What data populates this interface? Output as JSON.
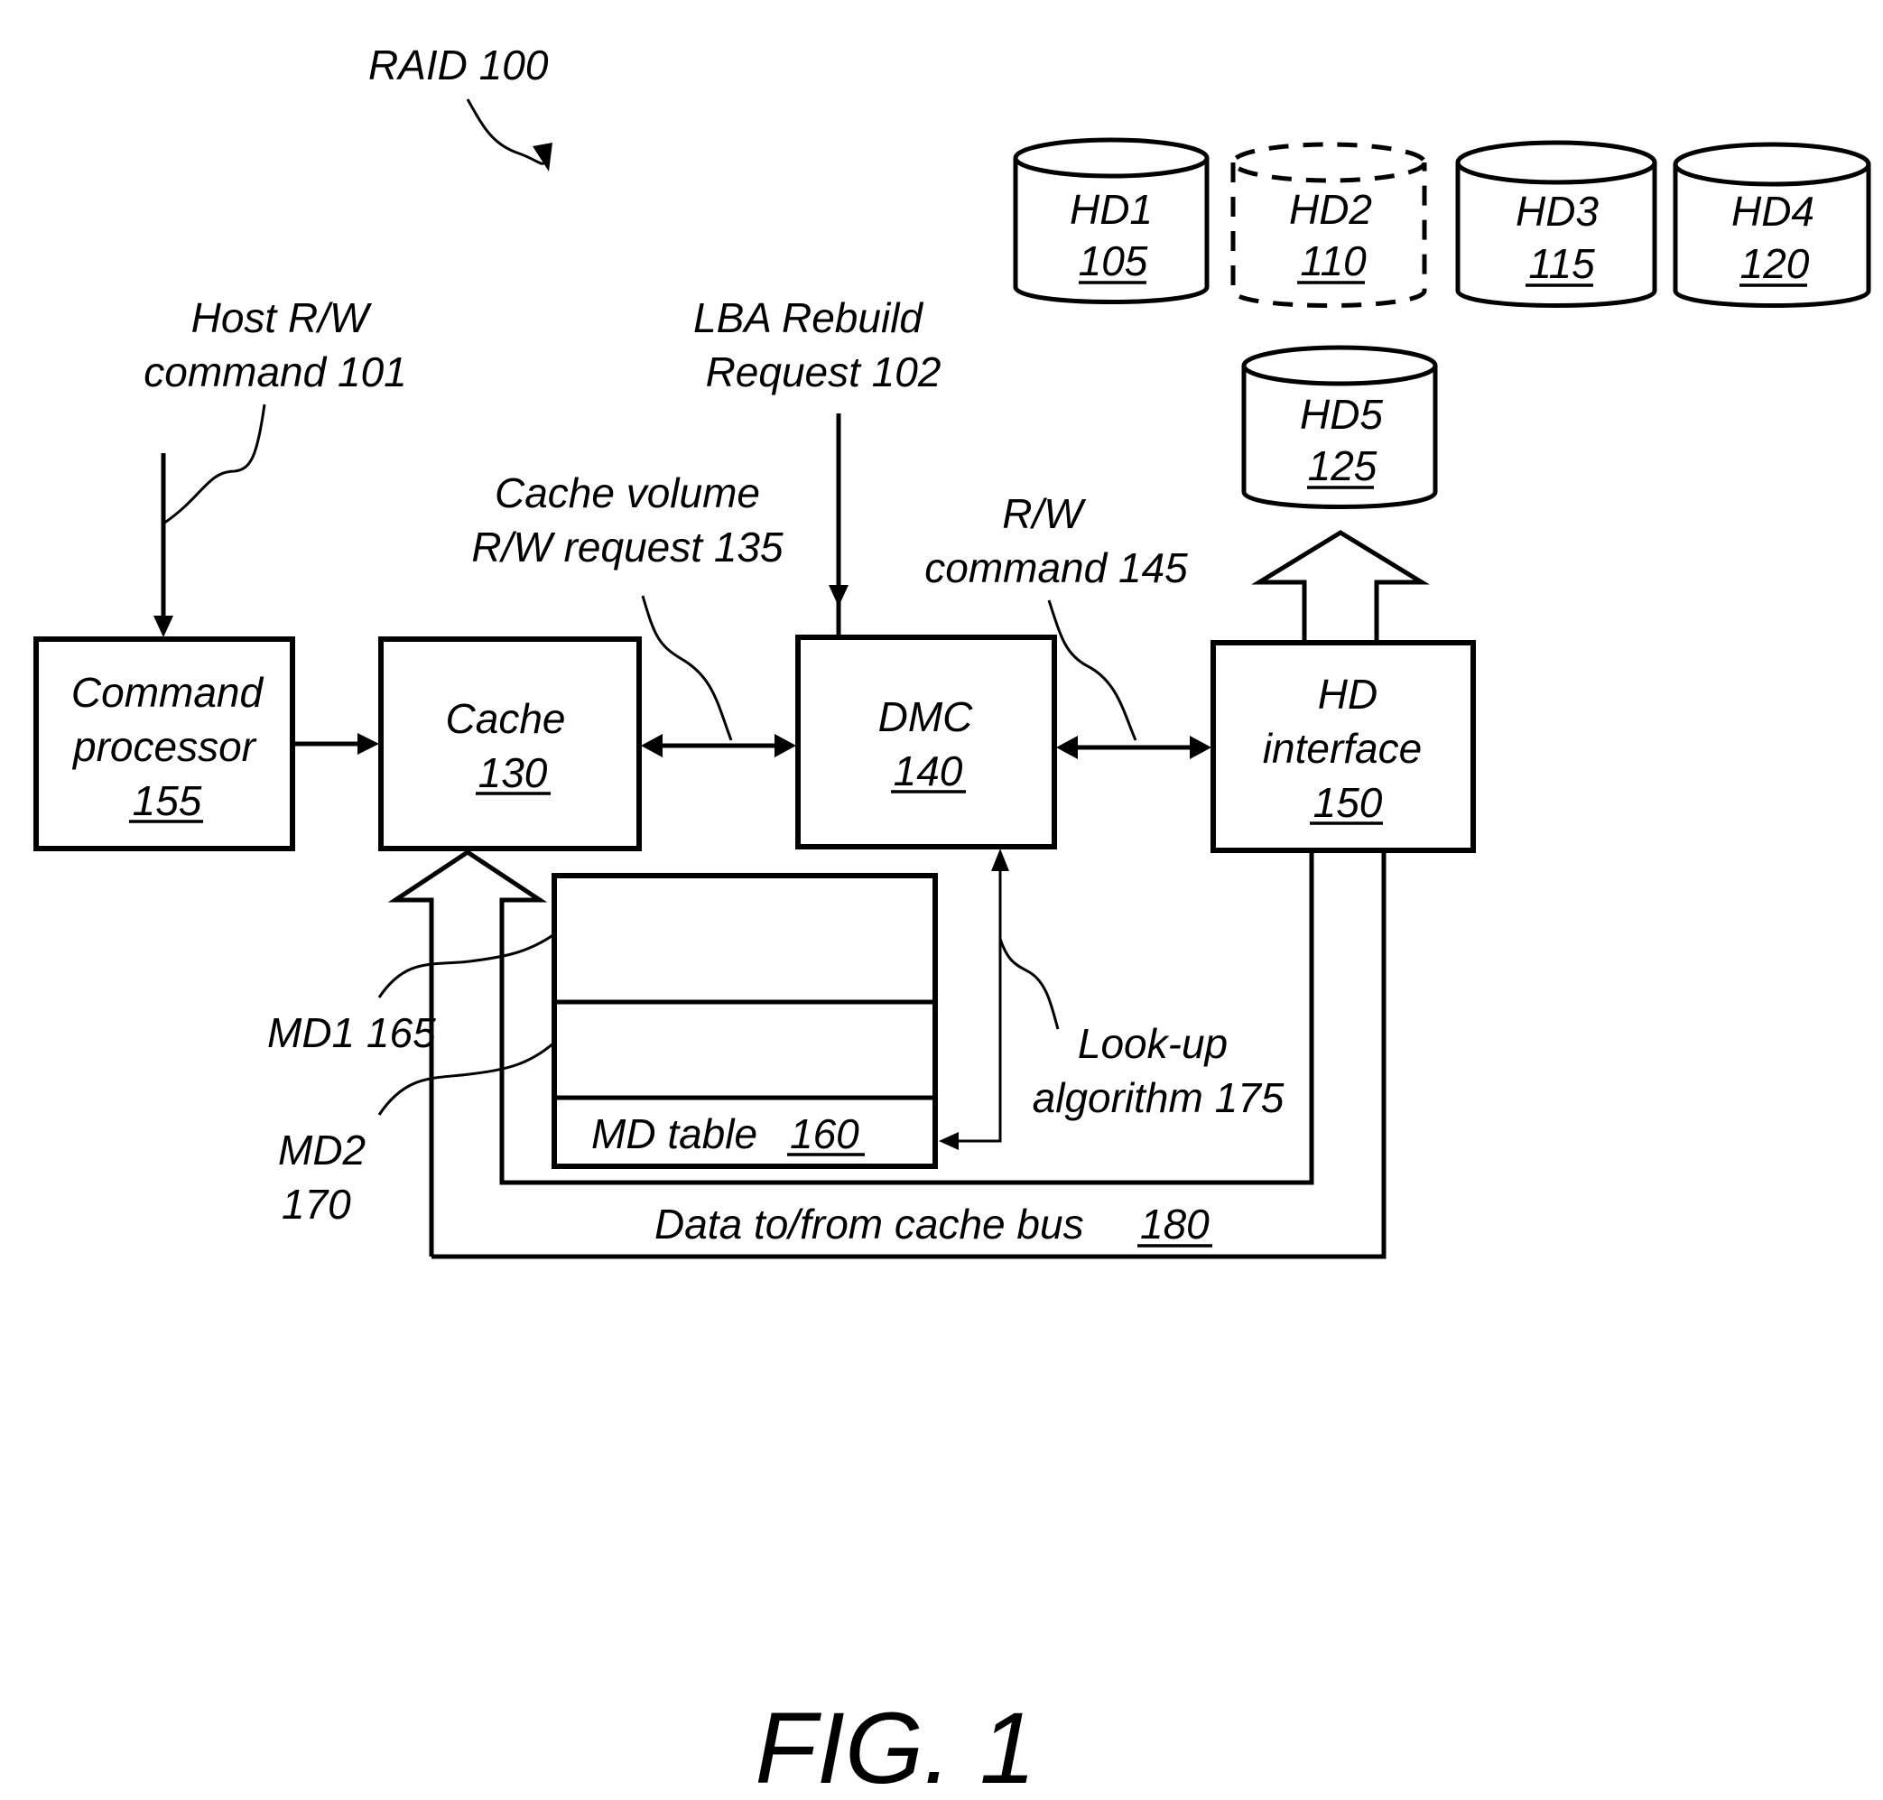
{
  "figure": {
    "caption": "FIG. 1",
    "system_label": "RAID 100"
  },
  "disks": [
    {
      "name": "HD1",
      "ref": "105",
      "state": "active"
    },
    {
      "name": "HD2",
      "ref": "110",
      "state": "failed (dashed)"
    },
    {
      "name": "HD3",
      "ref": "115",
      "state": "active"
    },
    {
      "name": "HD4",
      "ref": "120",
      "state": "active"
    },
    {
      "name": "HD5",
      "ref": "125",
      "state": "active"
    }
  ],
  "blocks": {
    "command_processor": {
      "line1": "Command",
      "line2": "processor",
      "ref": "155"
    },
    "cache": {
      "line1": "Cache",
      "ref": "130"
    },
    "dmc": {
      "line1": "DMC",
      "ref": "140"
    },
    "hd_interface": {
      "line1": "HD",
      "line2": "interface",
      "ref": "150"
    },
    "md_table": {
      "label": "MD table",
      "ref": "160"
    }
  },
  "labels": {
    "host_rw_1": "Host R/W",
    "host_rw_2": "command 101",
    "lba_1": "LBA Rebuild",
    "lba_2": "Request 102",
    "cache_vol_1": "Cache volume",
    "cache_vol_2": "R/W request 135",
    "rw_cmd_1": "R/W",
    "rw_cmd_2": "command 145",
    "md1": "MD1 165",
    "md2_1": "MD2",
    "md2_2": "170",
    "lookup_1": "Look-up",
    "lookup_2": "algorithm 175",
    "bus_label": "Data to/from cache bus",
    "bus_ref": "180"
  }
}
